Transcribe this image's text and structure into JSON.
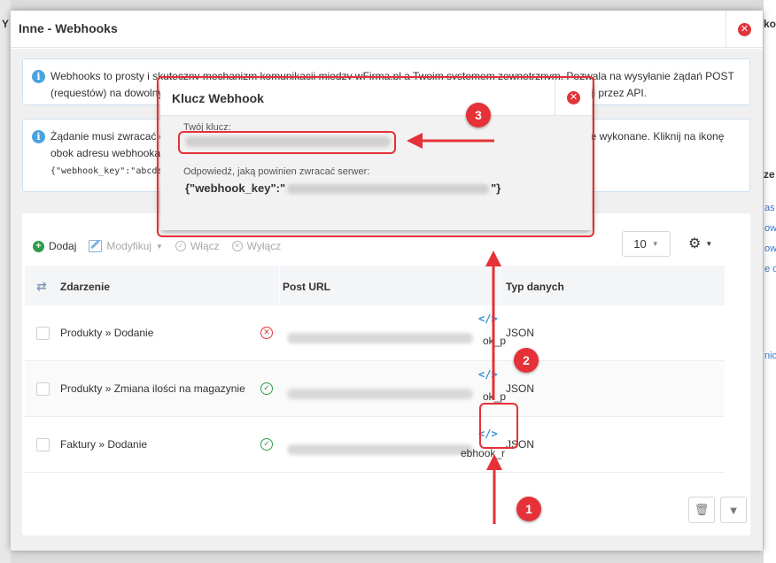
{
  "background": {
    "left_fragment": "Y",
    "right_heading": "ko",
    "right_heading2": "ze",
    "right_links": [
      "as",
      "ow",
      "ow",
      "e o",
      "nicy"
    ]
  },
  "modal": {
    "title": "Inne - Webhooks",
    "info1": "Webhooks to prosty i skuteczny mechanizm komunikacji między wFirma.pl a Twoim systemem zewnętrznym. Pozwala na wysyłanie żądań POST (requestów) na dowolny adres URL, w przypadku zajścia danego zdarzenia, bez konieczności odpytywania aplikacji przez API.",
    "info2": "Żądanie musi zwracać odpowiedź JSON zawierającą klucz webhooka, w przeciwnym wypadku żądanie nie zostanie wykonane. Kliknij na ikonę obok adresu webhooka, żeby podejrzeć klucz.",
    "info2_code": "{\"webhook_key\":\"abcde...\"}"
  },
  "toolbar": {
    "add": "Dodaj",
    "edit": "Modyfikuj",
    "enable": "Włącz",
    "disable": "Wyłącz",
    "page_size": "10"
  },
  "table": {
    "headers": {
      "event": "Zdarzenie",
      "url": "Post URL",
      "type": "Typ danych"
    },
    "rows": [
      {
        "event": "Produkty » Dodanie",
        "url_tail": "ok_p",
        "type": "JSON",
        "status": "error"
      },
      {
        "event": "Produkty » Zmiana ilości na magazynie",
        "url_tail": "ok_p",
        "type": "JSON",
        "status": "ok"
      },
      {
        "event": "Faktury » Dodanie",
        "url_tail": "ebhook_r",
        "type": "JSON",
        "status": "ok"
      }
    ]
  },
  "key_modal": {
    "title": "Klucz Webhook",
    "your_key_label": "Twój klucz:",
    "response_label": "Odpowiedź, jaką powinien zwracać serwer:",
    "response_prefix": "{\"webhook_key\":\"",
    "response_suffix": "\"}"
  },
  "annotations": {
    "n1": "1",
    "n2": "2",
    "n3": "3"
  },
  "colors": {
    "accent_red": "#e53137",
    "link_blue": "#2f8fd0",
    "success": "#2e9b4a",
    "error": "#e0353b"
  },
  "icons": {
    "close": "close-icon",
    "info": "info-icon",
    "add": "plus-circle-icon",
    "edit": "pencil-icon",
    "settings": "gear-icon",
    "code": "code-icon",
    "trash": "trash-icon",
    "filter": "filter-icon"
  }
}
